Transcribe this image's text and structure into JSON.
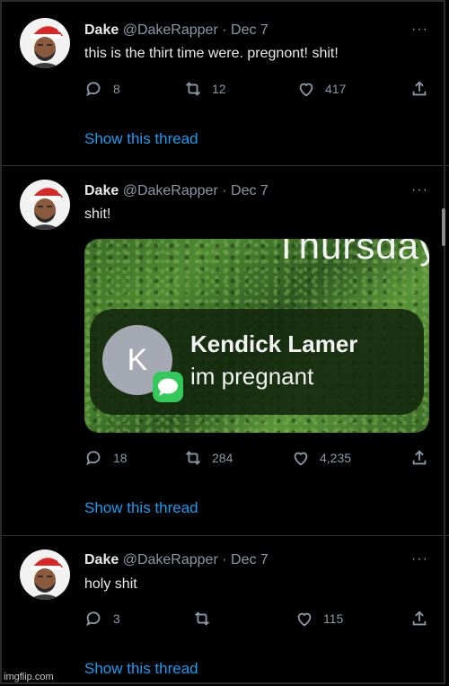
{
  "tweets": [
    {
      "name": "Dake",
      "handle": "@DakeRapper",
      "date": "· Dec 7",
      "text": "this is the thirt time were.  pregnont! shit!",
      "replies": "8",
      "retweets": "12",
      "likes": "417",
      "show_thread": "Show this thread"
    },
    {
      "name": "Dake",
      "handle": "@DakeRapper",
      "date": "· Dec 7",
      "text": "shit!",
      "media": {
        "overlay_text": "Thursday",
        "notification_avatar_letter": "K",
        "notification_title": "Kendick Lamer",
        "notification_body": "im pregnant"
      },
      "replies": "18",
      "retweets": "284",
      "likes": "4,235",
      "show_thread": "Show this thread"
    },
    {
      "name": "Dake",
      "handle": "@DakeRapper",
      "date": "· Dec 7",
      "text": "holy shit",
      "replies": "3",
      "retweets": "",
      "likes": "115",
      "show_thread": "Show this thread"
    }
  ],
  "more_label": "···",
  "watermark": "imgflip.com",
  "colors": {
    "background": "#000000",
    "link": "#1d9bf0",
    "muted": "#8b98a5",
    "text": "#e7e9ea"
  },
  "icons": [
    "reply-icon",
    "retweet-icon",
    "like-icon",
    "share-icon",
    "more-icon"
  ]
}
